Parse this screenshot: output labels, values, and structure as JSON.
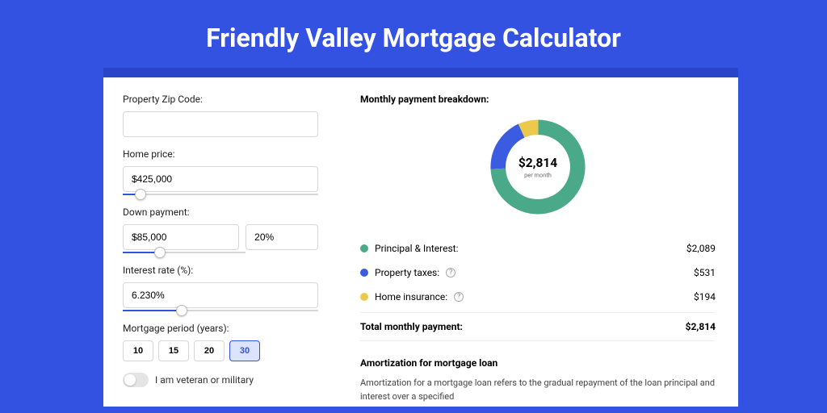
{
  "title": "Friendly Valley Mortgage Calculator",
  "form": {
    "zip_label": "Property Zip Code:",
    "zip_value": "",
    "home_price_label": "Home price:",
    "home_price_value": "$425,000",
    "home_price_slider_pct": 9,
    "down_payment_label": "Down payment:",
    "down_payment_value": "$85,000",
    "down_payment_pct_value": "20%",
    "down_payment_slider_pct": 20,
    "interest_label": "Interest rate (%):",
    "interest_value": "6.230%",
    "interest_slider_pct": 30,
    "period_label": "Mortgage period (years):",
    "periods": [
      "10",
      "15",
      "20",
      "30"
    ],
    "period_active": "30",
    "veteran_label": "I am veteran or military"
  },
  "breakdown": {
    "title": "Monthly payment breakdown:",
    "center_value": "$2,814",
    "center_sub": "per month",
    "items": [
      {
        "label": "Principal & Interest:",
        "value": "$2,089",
        "color": "green",
        "help": false
      },
      {
        "label": "Property taxes:",
        "value": "$531",
        "color": "blue",
        "help": true
      },
      {
        "label": "Home insurance:",
        "value": "$194",
        "color": "yellow",
        "help": true
      }
    ],
    "total_label": "Total monthly payment:",
    "total_value": "$2,814"
  },
  "chart_data": {
    "type": "pie",
    "title": "Monthly payment breakdown",
    "series": [
      {
        "name": "Principal & Interest",
        "value": 2089,
        "color": "#4aa989"
      },
      {
        "name": "Property taxes",
        "value": 531,
        "color": "#3b5be0"
      },
      {
        "name": "Home insurance",
        "value": 194,
        "color": "#ecc94b"
      }
    ],
    "total": 2814,
    "donut": true
  },
  "amort": {
    "title": "Amortization for mortgage loan",
    "text": "Amortization for a mortgage loan refers to the gradual repayment of the loan principal and interest over a specified"
  }
}
